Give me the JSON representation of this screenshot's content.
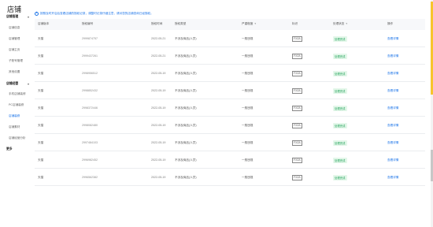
{
  "page": {
    "title": "店铺"
  },
  "sidebar": {
    "group1": "店铺管理",
    "group1_items": [
      "店铺信息",
      "店铺管理",
      "店铺主页",
      "子账号管理",
      "其他设置"
    ],
    "group2": "店铺经营",
    "group2_items": [
      "手机店铺装修",
      "PC店铺装修",
      "店铺装修",
      "店铺素材",
      "店铺经营分析"
    ],
    "more": "更多"
  },
  "notice": {
    "text": "按照及时开店后查看店铺的授权记录，调整时记录仔细注意，请对您的店铺查询已经授权。"
  },
  "table": {
    "headers": [
      "店铺版本",
      "授权编号",
      "授权时间",
      "授权类型",
      "严重程度",
      "标识",
      "处理状态",
      "操作"
    ],
    "sort_icons": {
      "severity": "▾",
      "status": "▾"
    },
    "rows": [
      {
        "version": "天猫",
        "id": "2999874757",
        "date": "2022-05-21",
        "type": "不涉及商品(人员)",
        "severity": "一般违规",
        "tag": "FXZA",
        "status": "处理完成",
        "action": "查看详情"
      },
      {
        "version": "天猫",
        "id": "2999437261",
        "date": "2022-05-21",
        "type": "不涉及商品(人员)",
        "severity": "一般违规",
        "tag": "FXZA",
        "status": "处理完成",
        "action": "查看详情"
      },
      {
        "version": "天猫",
        "id": "2998956512",
        "date": "2022-05-19",
        "type": "不涉及商品(人员)",
        "severity": "一般违规",
        "tag": "FXZA",
        "status": "处理完成",
        "action": "查看详情"
      },
      {
        "version": "天猫",
        "id": "2998852432",
        "date": "2022-05-19",
        "type": "不涉及商品(人员)",
        "severity": "一般违规",
        "tag": "FXZA",
        "status": "处理完成",
        "action": "查看详情"
      },
      {
        "version": "天猫",
        "id": "2998372446",
        "date": "2022-05-19",
        "type": "不涉及商品(人员)",
        "severity": "一般违规",
        "tag": "FXZA",
        "status": "处理完成",
        "action": "查看详情"
      },
      {
        "version": "天猫",
        "id": "2998082480",
        "date": "2022-05-19",
        "type": "不涉及商品(人员)",
        "severity": "一般违规",
        "tag": "FXZA",
        "status": "处理完成",
        "action": "查看详情"
      },
      {
        "version": "天猫",
        "id": "2997484103",
        "date": "2022-05-19",
        "type": "不涉及商品(人员)",
        "severity": "一般违规",
        "tag": "FXZA",
        "status": "处理完成",
        "action": "查看详情"
      },
      {
        "version": "天猫",
        "id": "2996982452",
        "date": "2022-05-19",
        "type": "不涉及商品(人员)",
        "severity": "一般违规",
        "tag": "FXZA",
        "status": "处理完成",
        "action": "查看详情"
      },
      {
        "version": "天猫",
        "id": "2996562382",
        "date": "2022-05-19",
        "type": "不涉及商品(人员)",
        "severity": "一般违规",
        "tag": "FXZA",
        "status": "处理完成",
        "action": "查看详情"
      }
    ]
  },
  "colors": {
    "accent": "#1a73e8",
    "success": "#21a35a",
    "scroll_thumb": "#f7c42d"
  },
  "icons": {
    "info": "info-icon",
    "chevron": "chevron-down-icon"
  }
}
